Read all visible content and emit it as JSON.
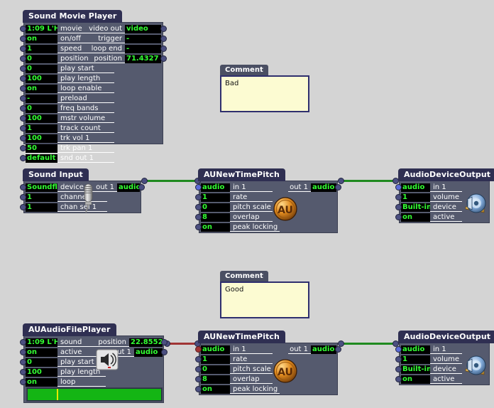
{
  "canvas": {
    "background": "#d4d4d4",
    "node_title_bg": "#2f2f52",
    "node_body_bg": "#555a6e",
    "value_text_color": "#33ff33",
    "comment_bg": "#fcfbd2",
    "conn_green": "#1f8a1f",
    "conn_red": "#a03535"
  },
  "nodes": {
    "sound_movie_player": {
      "title": "Sound Movie Player",
      "inputs": [
        {
          "value": "1:09 L'H",
          "label": "movie"
        },
        {
          "value": "on",
          "label": "on/off"
        },
        {
          "value": "1",
          "label": "speed"
        },
        {
          "value": "0",
          "label": "position"
        },
        {
          "value": "0",
          "label": "play start"
        },
        {
          "value": "100",
          "label": "play length"
        },
        {
          "value": "on",
          "label": "loop enable"
        },
        {
          "value": "-",
          "label": "preload"
        },
        {
          "value": "0",
          "label": "freq bands"
        },
        {
          "value": "100",
          "label": "mstr volume"
        },
        {
          "value": "1",
          "label": "track count"
        },
        {
          "value": "100",
          "label": "trk vol 1"
        },
        {
          "value": "50",
          "label": "trk pan 1"
        },
        {
          "value": "default",
          "label": "snd out 1"
        }
      ],
      "outputs": [
        {
          "label": "video out",
          "value": "video"
        },
        {
          "label": "trigger",
          "value": "-"
        },
        {
          "label": "loop end",
          "value": "-"
        },
        {
          "label": "position",
          "value": "71.4327"
        }
      ]
    },
    "sound_input": {
      "title": "Sound Input",
      "icon": "microphone-icon",
      "inputs": [
        {
          "value": "Soundflo",
          "label": "device"
        },
        {
          "value": "1",
          "label": "channels"
        },
        {
          "value": "1",
          "label": "chan sel 1"
        }
      ],
      "outputs": [
        {
          "label": "out 1",
          "value": "audio"
        }
      ]
    },
    "time_pitch_top": {
      "title": "AUNewTimePitch",
      "icon": "au-badge-icon",
      "inputs": [
        {
          "value": "audio",
          "label": "in 1"
        },
        {
          "value": "1",
          "label": "rate"
        },
        {
          "value": "0",
          "label": "pitch scale"
        },
        {
          "value": "8",
          "label": "overlap"
        },
        {
          "value": "on",
          "label": "peak locking"
        }
      ],
      "outputs": [
        {
          "label": "out 1",
          "value": "audio"
        }
      ]
    },
    "audio_output_top": {
      "title": "AudioDeviceOutput",
      "icon": "speaker-icon",
      "inputs": [
        {
          "value": "audio",
          "label": "in 1"
        },
        {
          "value": "1",
          "label": "volume"
        },
        {
          "value": "Built-in (",
          "label": "device"
        },
        {
          "value": "on",
          "label": "active"
        }
      ],
      "outputs": []
    },
    "audio_file_player": {
      "title": "AUAudioFilePlayer",
      "icon": "speaker-small-icon",
      "inputs": [
        {
          "value": "1:09 L'H",
          "label": "sound"
        },
        {
          "value": "on",
          "label": "active"
        },
        {
          "value": "0",
          "label": "play start"
        },
        {
          "value": "100",
          "label": "play length"
        },
        {
          "value": "on",
          "label": "loop"
        }
      ],
      "outputs": [
        {
          "label": "position",
          "value": "22.8552"
        },
        {
          "label": "out 1",
          "value": "audio"
        }
      ],
      "progress": {
        "percent": 100,
        "playhead_percent": 22
      }
    },
    "time_pitch_bottom": {
      "title": "AUNewTimePitch",
      "icon": "au-badge-icon",
      "inputs": [
        {
          "value": "audio",
          "label": "in 1"
        },
        {
          "value": "1",
          "label": "rate"
        },
        {
          "value": "0",
          "label": "pitch scale"
        },
        {
          "value": "8",
          "label": "overlap"
        },
        {
          "value": "on",
          "label": "peak locking"
        }
      ],
      "outputs": [
        {
          "label": "out 1",
          "value": "audio"
        }
      ]
    },
    "audio_output_bottom": {
      "title": "AudioDeviceOutput",
      "icon": "speaker-icon",
      "inputs": [
        {
          "value": "audio",
          "label": "in 1"
        },
        {
          "value": "1",
          "label": "volume"
        },
        {
          "value": "Built-in (",
          "label": "device"
        },
        {
          "value": "on",
          "label": "active"
        }
      ],
      "outputs": []
    },
    "comment_bad": {
      "title": "Comment",
      "text": "Bad"
    },
    "comment_good": {
      "title": "Comment",
      "text": "Good"
    }
  }
}
